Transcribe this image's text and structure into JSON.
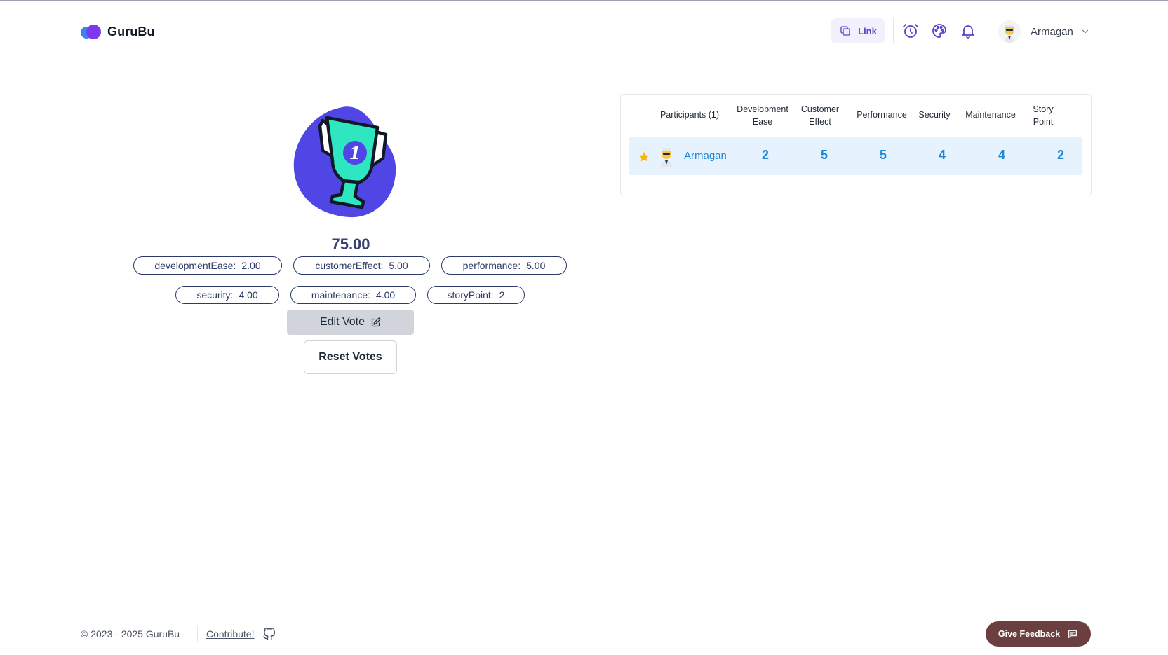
{
  "app": {
    "name": "GuruBu"
  },
  "header": {
    "link_label": "Link",
    "user_name": "Armagan",
    "icons": [
      "copy-icon",
      "alarm-clock-icon",
      "palette-icon",
      "bell-icon",
      "chevron-down-icon"
    ]
  },
  "result": {
    "score": "75.00",
    "metrics": [
      {
        "key": "developmentEase:",
        "value": "2.00"
      },
      {
        "key": "customerEffect:",
        "value": "5.00"
      },
      {
        "key": "performance:",
        "value": "5.00"
      },
      {
        "key": "security:",
        "value": "4.00"
      },
      {
        "key": "maintenance:",
        "value": "4.00"
      },
      {
        "key": "storyPoint:",
        "value": "2"
      }
    ],
    "edit_vote_label": "Edit Vote",
    "reset_votes_label": "Reset Votes"
  },
  "table": {
    "headers": {
      "participants": "Participants (1)",
      "development_ease_1": "Development",
      "development_ease_2": "Ease",
      "customer_effect_1": "Customer",
      "customer_effect_2": "Effect",
      "performance": "Performance",
      "security": "Security",
      "maintenance": "Maintenance",
      "story_point_1": "Story",
      "story_point_2": "Point"
    },
    "rows": [
      {
        "name": "Armagan",
        "development_ease": "2",
        "customer_effect": "5",
        "performance": "5",
        "security": "4",
        "maintenance": "4",
        "story_point": "2"
      }
    ]
  },
  "footer": {
    "copyright": "© 2023 - 2025 GuruBu",
    "contribute": "Contribute!",
    "feedback_label": "Give Feedback"
  },
  "colors": {
    "brand_purple": "#7c3aed",
    "brand_blue": "#3b82f6",
    "trophy_blob": "#4f46e5",
    "trophy_cup": "#2ee6c0",
    "table_value": "#1e88d6",
    "row_highlight": "#e6f2fd",
    "feedback_button": "#6b3f3f"
  }
}
